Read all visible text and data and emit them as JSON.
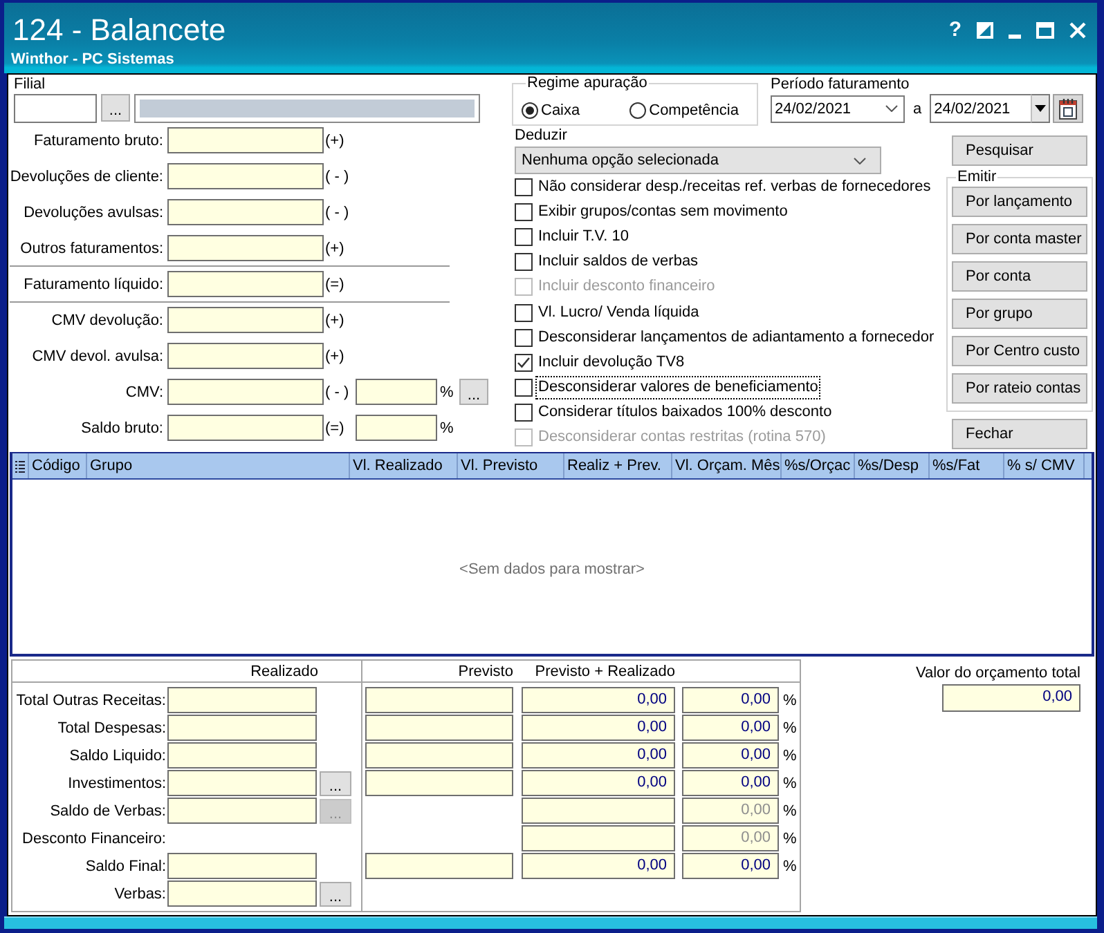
{
  "window": {
    "title": "124 - Balancete",
    "subtitle": "Winthor - PC Sistemas",
    "help": "?"
  },
  "filial": {
    "label": "Filial",
    "browse": "..."
  },
  "summary": {
    "sections": [
      {
        "rows": [
          {
            "label": "Faturamento bruto:",
            "sign": "(+)",
            "kind": "amount"
          },
          {
            "label": "Devoluções de cliente:",
            "sign": "( - )",
            "kind": "amount"
          },
          {
            "label": "Devoluções avulsas:",
            "sign": "( - )",
            "kind": "amount"
          },
          {
            "label": "Outros faturamentos:",
            "sign": "(+)",
            "kind": "amount"
          }
        ]
      },
      {
        "rows": [
          {
            "label": "Faturamento líquido:",
            "sign": "(=)",
            "kind": "amount"
          }
        ]
      },
      {
        "rows": [
          {
            "label": "CMV devolução:",
            "sign": "(+)",
            "kind": "amount"
          },
          {
            "label": "CMV devol. avulsa:",
            "sign": "(+)",
            "kind": "amount"
          },
          {
            "label": "CMV:",
            "sign": "( - )",
            "kind": "percent",
            "percent_unit": "%",
            "browse": "..."
          },
          {
            "label": "Saldo bruto:",
            "sign": "(=)",
            "kind": "percent",
            "percent_unit": "%"
          }
        ]
      }
    ]
  },
  "regime": {
    "title": "Regime apuração",
    "options": [
      {
        "label": "Caixa",
        "selected": true
      },
      {
        "label": "Competência",
        "selected": false
      }
    ]
  },
  "periodo": {
    "label": "Período faturamento",
    "from": "24/02/2021",
    "between": "a",
    "to": "24/02/2021"
  },
  "deduzir": {
    "label": "Deduzir",
    "value": "Nenhuma opção selecionada"
  },
  "options": [
    {
      "label": "Não considerar desp./receitas ref. verbas de fornecedores",
      "checked": false,
      "disabled": false,
      "focused": false
    },
    {
      "label": "Exibir grupos/contas sem movimento",
      "checked": false,
      "disabled": false,
      "focused": false
    },
    {
      "label": "Incluir T.V. 10",
      "checked": false,
      "disabled": false,
      "focused": false
    },
    {
      "label": "Incluir saldos de verbas",
      "checked": false,
      "disabled": false,
      "focused": false
    },
    {
      "label": "Incluir desconto financeiro",
      "checked": false,
      "disabled": true,
      "focused": false
    },
    {
      "label": "Vl. Lucro/ Venda líquida",
      "checked": false,
      "disabled": false,
      "focused": false
    },
    {
      "label": "Desconsiderar lançamentos de adiantamento a fornecedor",
      "checked": false,
      "disabled": false,
      "focused": false
    },
    {
      "label": "Incluir devolução TV8",
      "checked": true,
      "disabled": false,
      "focused": false
    },
    {
      "label": "Desconsiderar valores de beneficiamento",
      "checked": false,
      "disabled": false,
      "focused": true
    },
    {
      "label": "Considerar títulos baixados 100% desconto",
      "checked": false,
      "disabled": false,
      "focused": false
    },
    {
      "label": "Desconsiderar contas restritas (rotina 570)",
      "checked": false,
      "disabled": true,
      "focused": false
    }
  ],
  "search_button": "Pesquisar",
  "emitir": {
    "title": "Emitir",
    "buttons": [
      "Por lançamento",
      "Por conta master",
      "Por conta",
      "Por grupo",
      "Por Centro custo",
      "Por rateio contas"
    ]
  },
  "close_button": "Fechar",
  "grid": {
    "columns": [
      "Código",
      "Grupo",
      "Vl. Realizado",
      "Vl. Previsto",
      "Realiz + Prev.",
      "Vl. Orçam. Mês",
      "%s/Orçac",
      "%s/Desp",
      "%s/Fat",
      "% s/ CMV"
    ],
    "empty_text": "<Sem dados para mostrar>"
  },
  "totals": {
    "headers": {
      "realizado": "Realizado",
      "previsto": "Previsto",
      "combined": "Previsto + Realizado"
    },
    "rows": [
      {
        "label": "Total Outras Receitas:",
        "realizado_field": true,
        "previsto_field": true,
        "combined_field": true,
        "combined": "0,00",
        "percent": "0,00",
        "percent_disabled": false,
        "percent_unit": "%"
      },
      {
        "label": "Total Despesas:",
        "realizado_field": true,
        "previsto_field": true,
        "combined_field": true,
        "combined": "0,00",
        "percent": "0,00",
        "percent_disabled": false,
        "percent_unit": "%"
      },
      {
        "label": "Saldo Liquido:",
        "realizado_field": true,
        "previsto_field": true,
        "combined_field": true,
        "combined": "0,00",
        "percent": "0,00",
        "percent_disabled": false,
        "percent_unit": "%"
      },
      {
        "label": "Investimentos:",
        "realizado_field": true,
        "browse": {
          "text": "...",
          "disabled": false
        },
        "previsto_field": true,
        "combined_field": true,
        "combined": "0,00",
        "percent": "0,00",
        "percent_disabled": false,
        "percent_unit": "%"
      },
      {
        "label": "Saldo de Verbas:",
        "realizado_field": true,
        "browse": {
          "text": "...",
          "disabled": true
        },
        "previsto_field": false,
        "combined_field": true,
        "percent": "0,00",
        "percent_disabled": true,
        "percent_unit": "%"
      },
      {
        "label": "Desconto Financeiro:",
        "realizado_field": false,
        "previsto_field": false,
        "combined_field": true,
        "percent": "0,00",
        "percent_disabled": true,
        "percent_unit": "%"
      },
      {
        "label": "Saldo Final:",
        "realizado_field": true,
        "previsto_field": true,
        "combined_field": true,
        "combined": "0,00",
        "percent": "0,00",
        "percent_disabled": false,
        "percent_unit": "%"
      },
      {
        "label": "Verbas:",
        "realizado_field": true,
        "browse": {
          "text": "...",
          "disabled": false
        },
        "previsto_field": false,
        "combined_field": false
      }
    ]
  },
  "budget": {
    "label": "Valor do orçamento total",
    "value": "0,00"
  }
}
